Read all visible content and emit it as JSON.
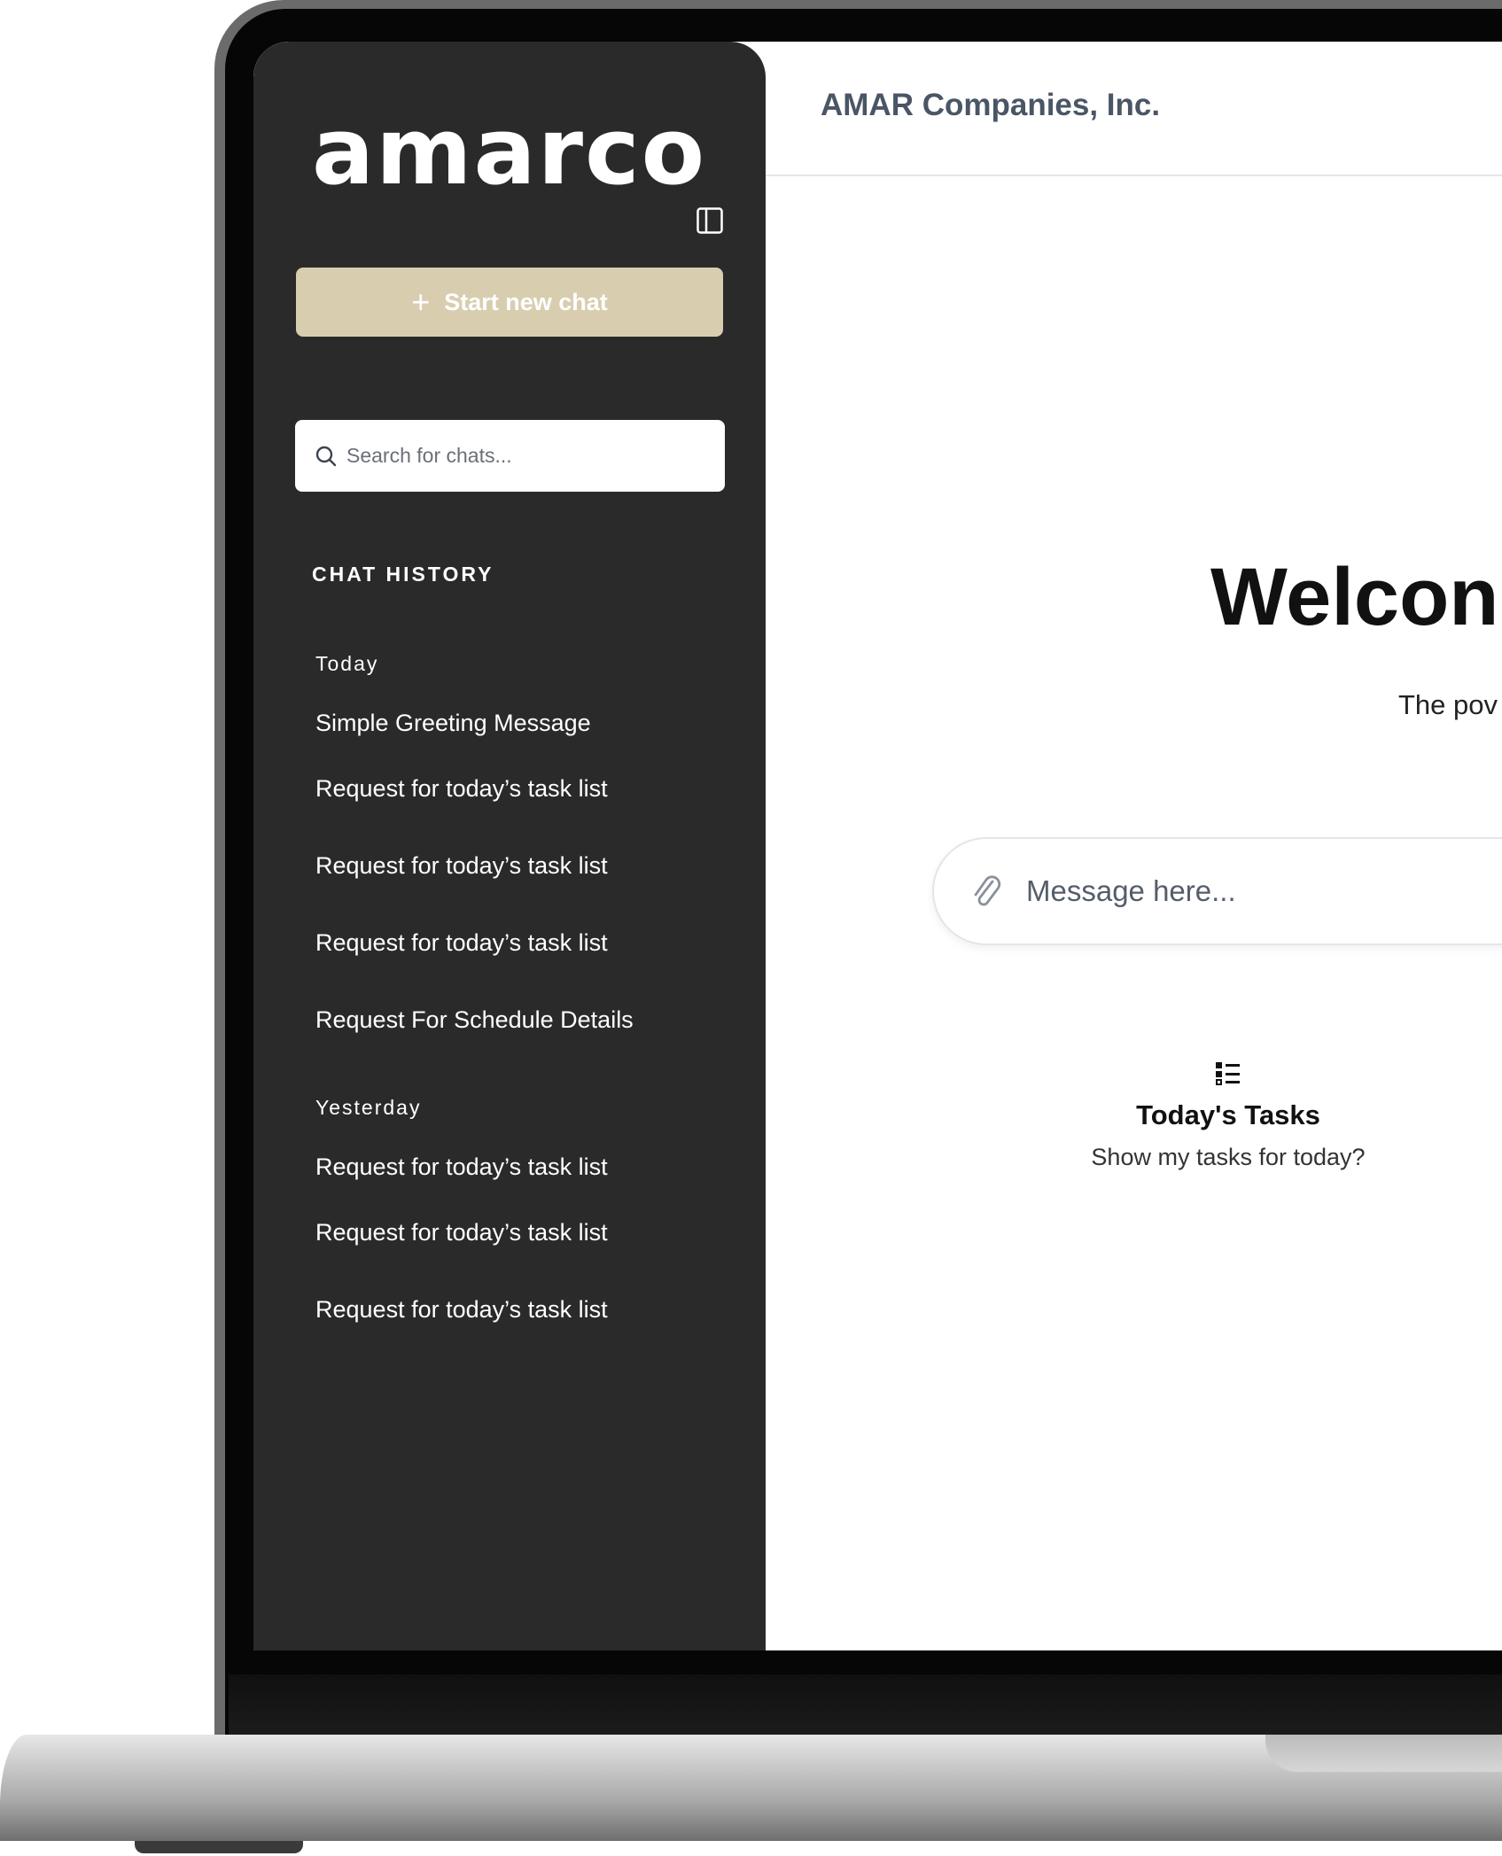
{
  "sidebar": {
    "logo_text": "amarco",
    "new_chat_label": "Start new chat",
    "search_placeholder": "Search for chats...",
    "history_title": "CHAT HISTORY",
    "groups": [
      {
        "label": "Today",
        "items": [
          "Simple Greeting Message",
          "Request for today’s task list",
          "Request for today’s task list",
          "Request for today’s task list",
          "Request For Schedule Details"
        ]
      },
      {
        "label": "Yesterday",
        "items": [
          "Request for today’s task list",
          "Request for today’s task list",
          "Request for today’s task list"
        ]
      }
    ]
  },
  "header": {
    "company": "AMAR Companies, Inc."
  },
  "main": {
    "welcome": "Welcon",
    "subtitle": "The pov",
    "message_placeholder": "Message here...",
    "task_card": {
      "icon": "list-icon",
      "title": "Today's Tasks",
      "description": "Show my tasks for today?"
    }
  },
  "colors": {
    "sidebar_bg": "#2a2a2a",
    "new_chat_bg": "#d8ceaf",
    "company_text": "#4a5565"
  }
}
